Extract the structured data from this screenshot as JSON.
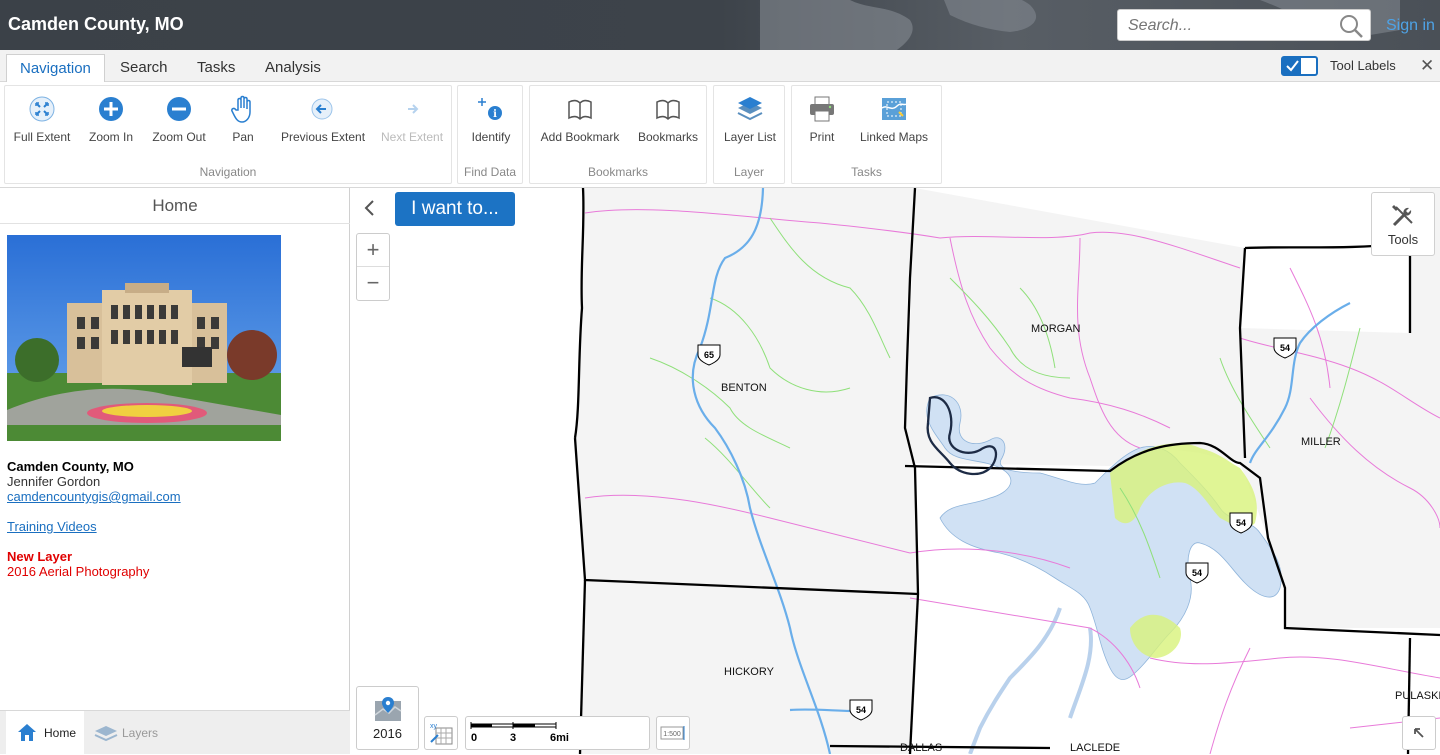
{
  "header": {
    "title": "Camden County, MO",
    "search_placeholder": "Search...",
    "sign_in": "Sign in"
  },
  "tabs": [
    {
      "label": "Navigation",
      "active": true
    },
    {
      "label": "Search"
    },
    {
      "label": "Tasks"
    },
    {
      "label": "Analysis"
    }
  ],
  "tool_labels": "Tool Labels",
  "toolbar": {
    "full_extent": "Full Extent",
    "zoom_in": "Zoom In",
    "zoom_out": "Zoom Out",
    "pan": "Pan",
    "previous_extent": "Previous Extent",
    "next_extent": "Next Extent",
    "identify": "Identify",
    "add_bookmark": "Add Bookmark",
    "bookmarks": "Bookmarks",
    "layer_list": "Layer List",
    "print": "Print",
    "linked_maps": "Linked Maps",
    "group_navigation": "Navigation",
    "group_find_data": "Find Data",
    "group_bookmarks": "Bookmarks",
    "group_layer": "Layer",
    "group_tasks": "Tasks"
  },
  "left_panel": {
    "title": "Home",
    "org_name": "Camden County, MO",
    "contact_name": "Jennifer Gordon",
    "email": "camdencountygis@gmail.com",
    "training_link": "Training Videos",
    "new_layer_heading": "New Layer",
    "new_layer_text": "2016 Aerial Photography",
    "bottom_tabs": {
      "home": "Home",
      "layers": "Layers"
    }
  },
  "map": {
    "i_want_to": "I want to...",
    "tools": "Tools",
    "basemap_year": "2016",
    "scale": {
      "ticks": [
        "0",
        "3",
        "6mi"
      ]
    },
    "scale_ratio_icon": "1:500",
    "counties": [
      "BENTON",
      "MORGAN",
      "MILLER",
      "HICKORY",
      "PULASKI",
      "DALLAS",
      "LACLEDE"
    ],
    "highways": [
      "65",
      "54",
      "54",
      "54",
      "54"
    ]
  },
  "colors": {
    "accent": "#1c73c4",
    "header_bg": "#3d434a",
    "new_layer_red": "#e00000",
    "water": "#c9dcf3",
    "river": "#6aaeea",
    "roads_pink": "#e87ad9",
    "roads_green": "#8fe07a"
  }
}
